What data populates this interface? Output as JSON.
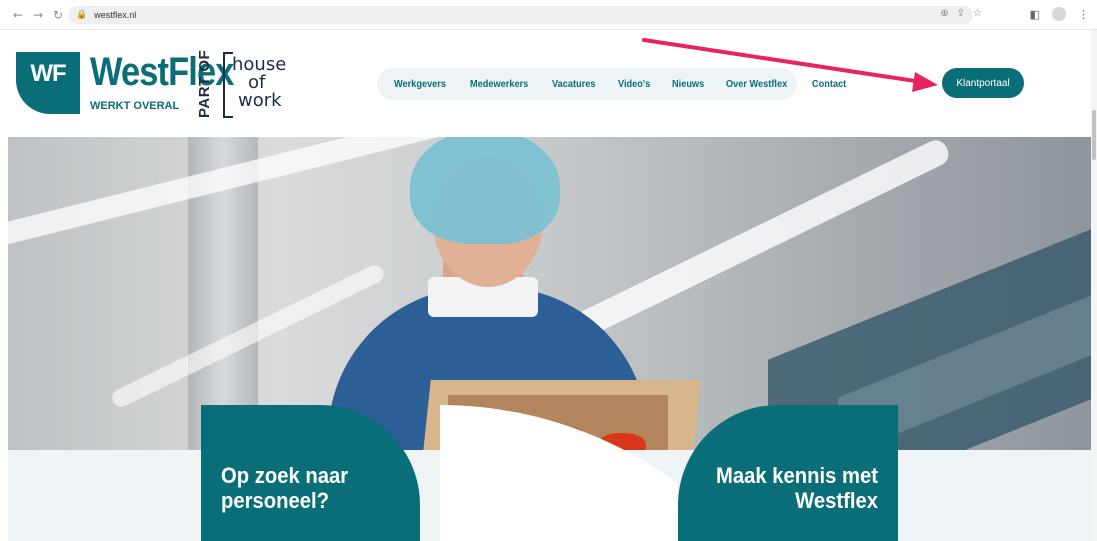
{
  "browser": {
    "url": "westflex.nl",
    "icons": [
      "back-icon",
      "forward-icon",
      "reload-icon",
      "lock-icon",
      "zoom-icon",
      "share-icon",
      "star-icon",
      "sidepanel-icon",
      "profile-icon",
      "menu-icon"
    ]
  },
  "logo": {
    "mark": "WF",
    "name": "WestFlex",
    "tagline": "WERKT OVERAL"
  },
  "partner": {
    "part_of": "PART OF",
    "house": "house",
    "of": "of",
    "work": "work"
  },
  "nav": {
    "items": [
      {
        "label": "Werkgevers"
      },
      {
        "label": "Medewerkers"
      },
      {
        "label": "Vacatures"
      },
      {
        "label": "Video's"
      },
      {
        "label": "Nieuws"
      },
      {
        "label": "Over Westflex"
      },
      {
        "label": "Contact"
      }
    ],
    "cta": "Klantportaal"
  },
  "cards": {
    "left_title": "Op zoek naar personeel?",
    "right_title": "Maak kennis met Westflex"
  },
  "colors": {
    "brand": "#0a6e78",
    "arrow": "#e8235e",
    "light_bg": "#eef4f6"
  }
}
